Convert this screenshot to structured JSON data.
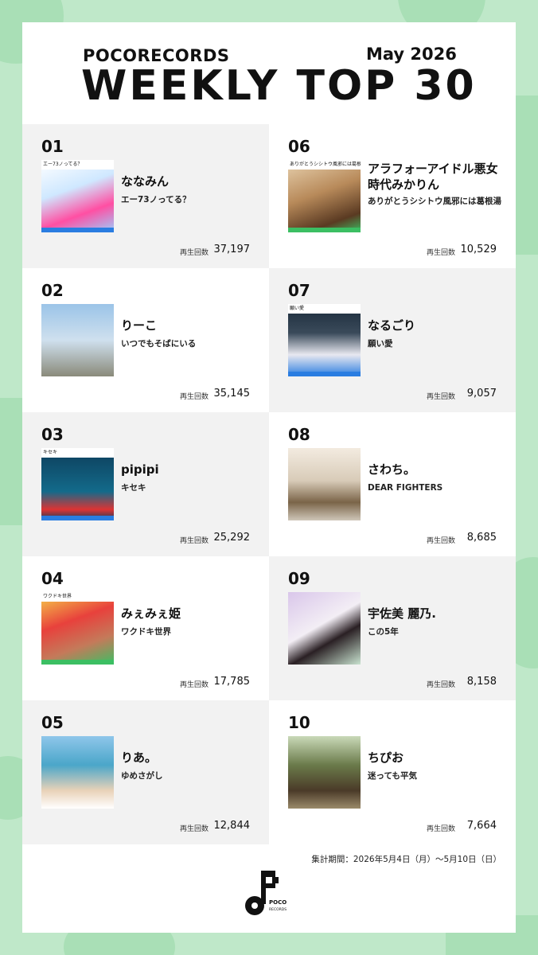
{
  "header": {
    "brand": "POCORECORDS",
    "title": "WEEKLY TOP 30",
    "month": "May 2026"
  },
  "plays_label": "再生回数",
  "colors": {
    "background": "#bfe8c9",
    "card": "#ffffff",
    "cell_gray": "#f2f2f2",
    "accent_blue": "#2a7de1",
    "accent_green": "#3cbf63"
  },
  "entries": [
    {
      "rank": "01",
      "artist": "ななみん",
      "song": "エー73ノってる？",
      "plays": "37,197",
      "jacket_title": "エー73ノってる？",
      "jacket_artist": "ななみん"
    },
    {
      "rank": "02",
      "artist": "りーこ",
      "song": "いつでもそばにいる",
      "plays": "35,145"
    },
    {
      "rank": "03",
      "artist": "pipipi",
      "song": "キセキ",
      "plays": "25,292",
      "jacket_title": "キセキ",
      "jacket_artist": "pipipi"
    },
    {
      "rank": "04",
      "artist": "みぇみぇ姫",
      "song": "ワクドキ世界",
      "plays": "17,785",
      "jacket_title": "ワクドキ世界",
      "jacket_artist": "みぇみぇ姫"
    },
    {
      "rank": "05",
      "artist": "りあ。",
      "song": "ゆめさがし",
      "plays": "12,844"
    },
    {
      "rank": "06",
      "artist": "アラフォーアイドル悪女時代みかりん",
      "song": "ありがとうシシトウ風邪には葛根湯",
      "plays": "10,529",
      "jacket_title": "ありがとうシシトウ風邪には葛根湯"
    },
    {
      "rank": "07",
      "artist": "なるごり",
      "song": "願い愛",
      "plays": "9,057",
      "jacket_title": "願い愛",
      "jacket_artist": "なるごり"
    },
    {
      "rank": "08",
      "artist": "さわち。",
      "song": "DEAR FIGHTERS",
      "plays": "8,685"
    },
    {
      "rank": "09",
      "artist": "宇佐美 麗乃.",
      "song": "この5年",
      "plays": "8,158"
    },
    {
      "rank": "10",
      "artist": "ちぴお",
      "song": "迷っても平気",
      "plays": "7,664"
    }
  ],
  "footer": {
    "period": "集計期間：2026年5月4日（月）〜5月10日（日）",
    "logo_text_1": "POCO",
    "logo_text_2": "RECORDS"
  }
}
